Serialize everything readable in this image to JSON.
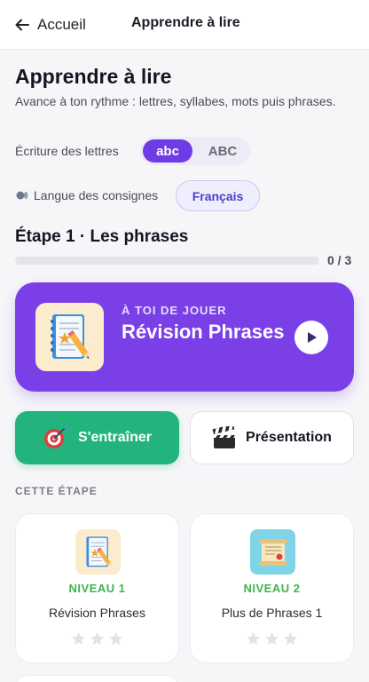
{
  "topbar": {
    "back_label": "Accueil",
    "title": "Apprendre à lire"
  },
  "header": {
    "title": "Apprendre à lire",
    "subtitle": "Avance à ton rythme : lettres, syllabes, mots puis phrases."
  },
  "writing": {
    "label": "Écriture des lettres",
    "options": [
      "abc",
      "ABC"
    ],
    "selected": "abc"
  },
  "language": {
    "label": "Langue des consignes",
    "value": "Français"
  },
  "stage": {
    "title": "Étape 1 · Les phrases",
    "progress_text": "0 / 3",
    "progress_fraction": 0
  },
  "hero": {
    "kicker": "À TOI DE JOUER",
    "title": "Révision Phrases"
  },
  "actions": {
    "practice_label": "S'entraîner",
    "presentation_label": "Présentation"
  },
  "section_label": "CETTE ÉTAPE",
  "levels": [
    {
      "level": "NIVEAU 1",
      "name": "Révision Phrases",
      "stars": 0,
      "icon": "notebook-icon"
    },
    {
      "level": "NIVEAU 2",
      "name": "Plus de Phrases 1",
      "stars": 0,
      "icon": "scroll-icon"
    }
  ],
  "colors": {
    "accent": "#6e3ce6",
    "hero": "#7b3fe8",
    "success": "#22b47c",
    "level": "#3fb44e"
  }
}
